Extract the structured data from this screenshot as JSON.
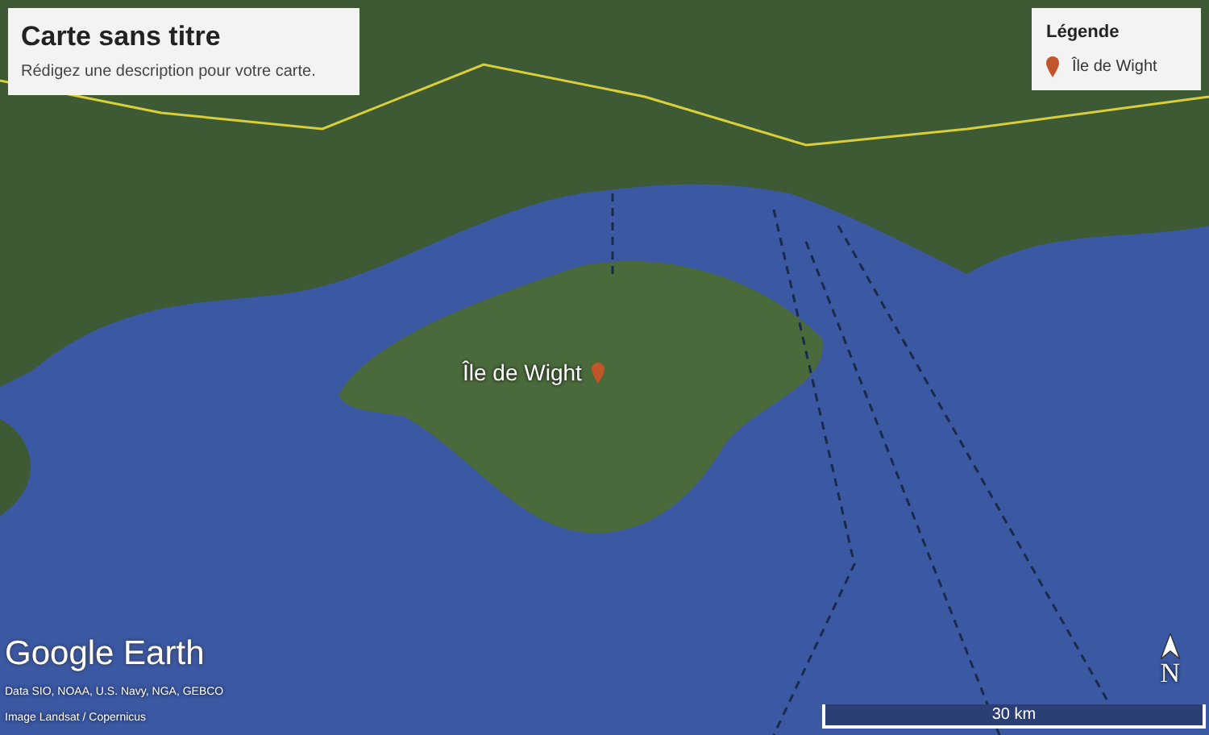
{
  "title_card": {
    "title": "Carte sans titre",
    "description": "Rédigez une description pour votre carte."
  },
  "legend": {
    "title": "Légende",
    "items": [
      {
        "label": "Île de Wight",
        "color": "#c0562a"
      }
    ]
  },
  "placemark": {
    "label": "Île de Wight",
    "color": "#c0562a"
  },
  "logo": {
    "text": "Google Earth"
  },
  "attribution": [
    "Data SIO, NOAA, U.S. Navy, NGA, GEBCO",
    "Image Landsat / Copernicus"
  ],
  "scale_bar": {
    "label": "30 km"
  },
  "north": {
    "label": "N"
  }
}
